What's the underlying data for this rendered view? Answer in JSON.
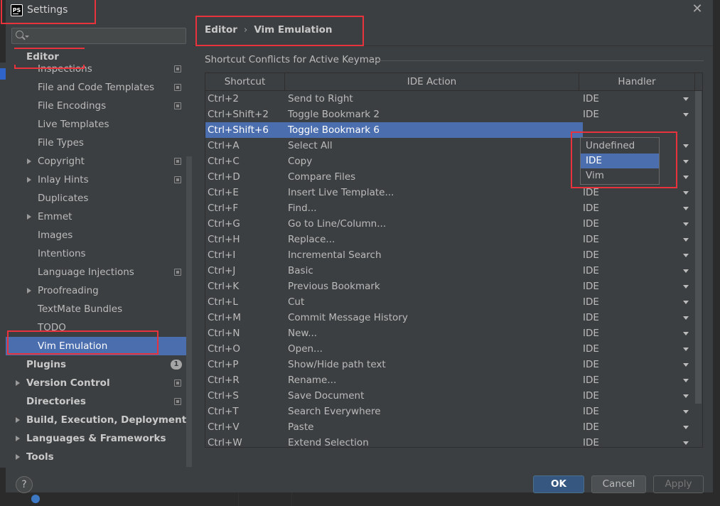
{
  "window": {
    "title": "Settings",
    "app_icon": "PS"
  },
  "search": {
    "placeholder": ""
  },
  "sidebar": {
    "items": [
      {
        "label": "Editor",
        "level": 0,
        "expandable": false,
        "config_icon": false
      },
      {
        "label": "Inspections",
        "level": 1,
        "expandable": false,
        "config_icon": true
      },
      {
        "label": "File and Code Templates",
        "level": 1,
        "expandable": false,
        "config_icon": true
      },
      {
        "label": "File Encodings",
        "level": 1,
        "expandable": false,
        "config_icon": true
      },
      {
        "label": "Live Templates",
        "level": 1,
        "expandable": false,
        "config_icon": false
      },
      {
        "label": "File Types",
        "level": 1,
        "expandable": false,
        "config_icon": false
      },
      {
        "label": "Copyright",
        "level": 1,
        "expandable": true,
        "config_icon": true
      },
      {
        "label": "Inlay Hints",
        "level": 1,
        "expandable": true,
        "config_icon": true
      },
      {
        "label": "Duplicates",
        "level": 1,
        "expandable": false,
        "config_icon": false
      },
      {
        "label": "Emmet",
        "level": 1,
        "expandable": true,
        "config_icon": false
      },
      {
        "label": "Images",
        "level": 1,
        "expandable": false,
        "config_icon": false
      },
      {
        "label": "Intentions",
        "level": 1,
        "expandable": false,
        "config_icon": false
      },
      {
        "label": "Language Injections",
        "level": 1,
        "expandable": false,
        "config_icon": true
      },
      {
        "label": "Proofreading",
        "level": 1,
        "expandable": true,
        "config_icon": false
      },
      {
        "label": "TextMate Bundles",
        "level": 1,
        "expandable": false,
        "config_icon": false
      },
      {
        "label": "TODO",
        "level": 1,
        "expandable": false,
        "config_icon": false
      },
      {
        "label": "Vim Emulation",
        "level": 1,
        "expandable": false,
        "config_icon": false,
        "selected": true
      },
      {
        "label": "Plugins",
        "level": 0,
        "expandable": false,
        "config_icon": false,
        "badge": "1"
      },
      {
        "label": "Version Control",
        "level": 0,
        "expandable": true,
        "config_icon": true
      },
      {
        "label": "Directories",
        "level": 0,
        "expandable": false,
        "config_icon": true
      },
      {
        "label": "Build, Execution, Deployment",
        "level": 0,
        "expandable": true,
        "config_icon": false
      },
      {
        "label": "Languages & Frameworks",
        "level": 0,
        "expandable": true,
        "config_icon": false
      },
      {
        "label": "Tools",
        "level": 0,
        "expandable": true,
        "config_icon": false
      }
    ]
  },
  "breadcrumb": {
    "parent": "Editor",
    "separator": "›",
    "current": "Vim Emulation"
  },
  "section": {
    "title": "Shortcut Conflicts for Active Keymap"
  },
  "table": {
    "columns": [
      "Shortcut",
      "IDE Action",
      "Handler"
    ],
    "rows": [
      {
        "shortcut": "Ctrl+2",
        "action": "Send to Right",
        "handler": "IDE"
      },
      {
        "shortcut": "Ctrl+Shift+2",
        "action": "Toggle Bookmark 2",
        "handler": "IDE"
      },
      {
        "shortcut": "Ctrl+Shift+6",
        "action": "Toggle Bookmark 6",
        "handler": "",
        "selected": true
      },
      {
        "shortcut": "Ctrl+A",
        "action": "Select All",
        "handler": ""
      },
      {
        "shortcut": "Ctrl+C",
        "action": "Copy",
        "handler": ""
      },
      {
        "shortcut": "Ctrl+D",
        "action": "Compare Files",
        "handler": ""
      },
      {
        "shortcut": "Ctrl+E",
        "action": "Insert Live Template...",
        "handler": "IDE"
      },
      {
        "shortcut": "Ctrl+F",
        "action": "Find...",
        "handler": "IDE"
      },
      {
        "shortcut": "Ctrl+G",
        "action": "Go to Line/Column...",
        "handler": "IDE"
      },
      {
        "shortcut": "Ctrl+H",
        "action": "Replace...",
        "handler": "IDE"
      },
      {
        "shortcut": "Ctrl+I",
        "action": "Incremental Search",
        "handler": "IDE"
      },
      {
        "shortcut": "Ctrl+J",
        "action": "Basic",
        "handler": "IDE"
      },
      {
        "shortcut": "Ctrl+K",
        "action": "Previous Bookmark",
        "handler": "IDE"
      },
      {
        "shortcut": "Ctrl+L",
        "action": "Cut",
        "handler": "IDE"
      },
      {
        "shortcut": "Ctrl+M",
        "action": "Commit Message History",
        "handler": "IDE"
      },
      {
        "shortcut": "Ctrl+N",
        "action": "New...",
        "handler": "IDE"
      },
      {
        "shortcut": "Ctrl+O",
        "action": "Open...",
        "handler": "IDE"
      },
      {
        "shortcut": "Ctrl+P",
        "action": "Show/Hide path text",
        "handler": "IDE"
      },
      {
        "shortcut": "Ctrl+R",
        "action": "Rename...",
        "handler": "IDE"
      },
      {
        "shortcut": "Ctrl+S",
        "action": "Save Document",
        "handler": "IDE"
      },
      {
        "shortcut": "Ctrl+T",
        "action": "Search Everywhere",
        "handler": "IDE"
      },
      {
        "shortcut": "Ctrl+V",
        "action": "Paste",
        "handler": "IDE"
      },
      {
        "shortcut": "Ctrl+W",
        "action": "Extend Selection",
        "handler": "IDE"
      }
    ]
  },
  "handler_dropdown": {
    "options": [
      "Undefined",
      "IDE",
      "Vim"
    ],
    "selected": "IDE"
  },
  "footer": {
    "help_label": "?",
    "ok_label": "OK",
    "cancel_label": "Cancel",
    "apply_label": "Apply"
  },
  "colors": {
    "selection": "#4b6eaf",
    "annotation": "#e8323c",
    "ok_button": "#365880",
    "background": "#3c3f41"
  }
}
